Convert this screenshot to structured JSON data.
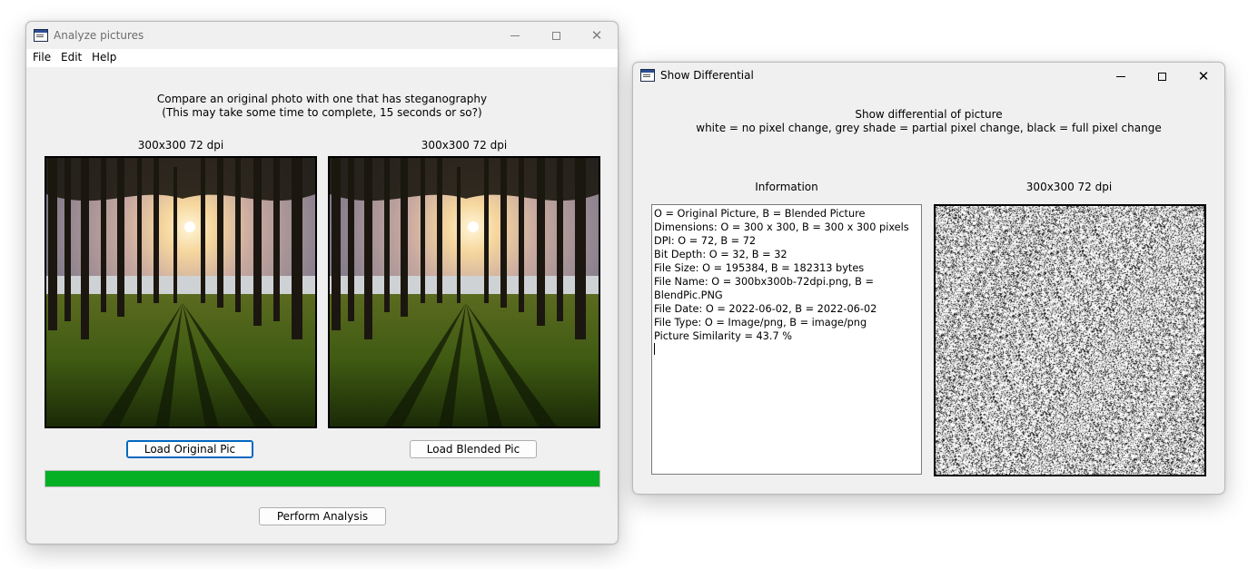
{
  "analyze_window": {
    "title": "Analyze pictures",
    "menu": [
      "File",
      "Edit",
      "Help"
    ],
    "instructions_line1": "Compare an original photo with one that has steganography",
    "instructions_line2": "(This may take some time to complete, 15 seconds or so?)",
    "original_caption": "300x300 72 dpi",
    "blended_caption": "300x300 72 dpi",
    "load_original_label": "Load Original Pic",
    "load_blended_label": "Load Blended Pic",
    "progress_percent": 100,
    "progress_color": "#06b025",
    "perform_analysis_label": "Perform Analysis"
  },
  "differential_window": {
    "title": "Show Differential",
    "heading_line1": "Show differential of picture",
    "heading_line2": "white = no pixel change, grey shade = partial pixel change, black = full pixel change",
    "info_label": "Information",
    "diff_caption": "300x300 72 dpi",
    "info_lines": [
      "O = Original Picture, B = Blended Picture",
      "Dimensions: O = 300 x 300, B = 300 x 300 pixels",
      "DPI: O = 72, B = 72",
      "Bit Depth: O = 32, B = 32",
      "File Size: O = 195384, B = 182313 bytes",
      "File Name: O = 300bx300b-72dpi.png, B = BlendPic.PNG",
      "File Date: O = 2022-06-02, B = 2022-06-02",
      "File Type: O = Image/png, B = image/png",
      "Picture Similarity = 43.7 %"
    ]
  },
  "icons": {
    "minimize": "minimize-icon",
    "maximize": "maximize-icon",
    "close": "close-icon",
    "app": "app-window-icon"
  }
}
